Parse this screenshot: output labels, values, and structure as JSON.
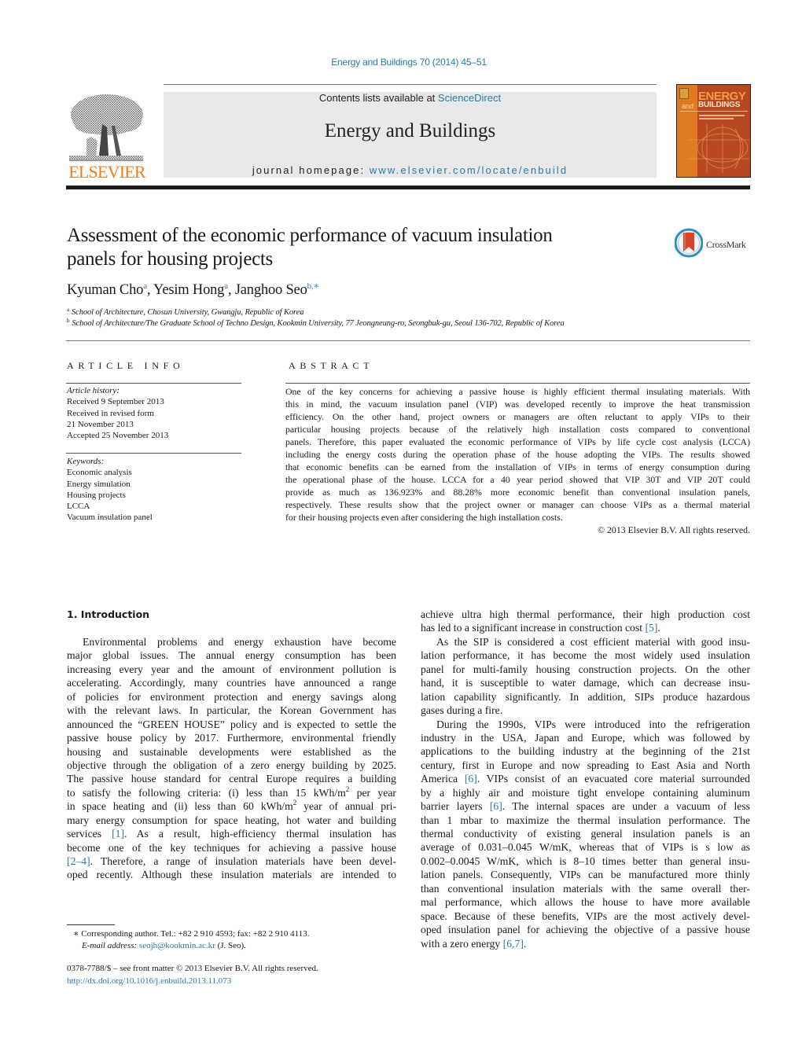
{
  "header": {
    "citation": "Energy and Buildings 70 (2014) 45–51",
    "contents_prefix": "Contents lists available at ",
    "contents_link": "ScienceDirect",
    "journal_title": "Energy and Buildings",
    "homepage_prefix": "journal homepage: ",
    "homepage_link": "www.elsevier.com/locate/enbuild",
    "publisher_logo_text": "ELSEVIER",
    "cover": {
      "line1": "ENERGY",
      "and": "and",
      "line2": "BUILDINGS"
    },
    "colors": {
      "link": "#2a7aa8",
      "elsevier_orange": "#f07d1a",
      "banner_gray": "#e9e9ea",
      "cover_brown": "#b8481f"
    }
  },
  "article": {
    "title_line1": "Assessment of the economic performance of vacuum insulation",
    "title_line2": "panels for housing projects",
    "crossmark_label": "CrossMark",
    "authors": [
      {
        "name": "Kyuman Cho",
        "sup": "a"
      },
      {
        "name": "Yesim Hong",
        "sup": "a"
      },
      {
        "name": "Janghoo Seo",
        "sup": "b,∗"
      }
    ],
    "affiliations": [
      {
        "sup": "a",
        "text": "School of Architecture, Chosun University, Gwangju, Republic of Korea"
      },
      {
        "sup": "b",
        "text": "School of Architecture/The Graduate School of Techno Design, Kookmin University, 77 Jeongneung-ro, Seongbuk-gu, Seoul 136-702, Republic of Korea"
      }
    ]
  },
  "article_info": {
    "heading": "ARTICLE INFO",
    "history_label": "Article history:",
    "history": [
      "Received 9 September 2013",
      "Received in revised form",
      "21 November 2013",
      "Accepted 25 November 2013"
    ],
    "keywords_label": "Keywords:",
    "keywords": [
      "Economic analysis",
      "Energy simulation",
      "Housing projects",
      "LCCA",
      "Vacuum insulation panel"
    ]
  },
  "abstract": {
    "heading": "ABSTRACT",
    "lines": [
      "One of the key concerns for achieving a passive house is highly efficient thermal insulating materials. With",
      "this in mind, the vacuum insulation panel (VIP) was developed recently to improve the heat transmission",
      "efficiency. On the other hand, project owners or managers are often reluctant to apply VIPs to their",
      "particular housing projects because of the relatively high installation costs compared to conventional",
      "panels. Therefore, this paper evaluated the economic performance of VIPs by life cycle cost analysis (LCCA)",
      "including the energy costs during the operation phase of the house adopting the VIPs. The results showed",
      "that economic benefits can be earned from the installation of VIPs in terms of energy consumption during",
      "the operational phase of the house. LCCA for a 40 year period showed that VIP 30T and VIP 20T could",
      "provide as much as 136.923% and 88.28% more economic benefit than conventional insulation panels,",
      "respectively. These results show that the project owner or manager can choose VIPs as a thermal material",
      "for their housing projects even after considering the high installation costs."
    ],
    "copyright": "© 2013 Elsevier B.V. All rights reserved."
  },
  "body": {
    "section_heading": "1.  Introduction",
    "left_lines": [
      "Environmental problems and energy exhaustion have become",
      "major global issues. The annual energy consumption has been",
      "increasing every year and the amount of environment pollution is",
      "accelerating. Accordingly, many countries have announced a range",
      "of policies for environment protection and energy savings along",
      "with the relevant laws. In particular, the Korean Government has",
      "announced the “GREEN HOUSE” policy and is expected to settle the",
      "passive house policy by 2017. Furthermore, environmental friendly",
      "housing and sustainable developments were established as the",
      "objective through the obligation of a zero energy building by 2025.",
      "The passive house standard for central Europe requires a building"
    ],
    "left_line_12": {
      "before": "to satisfy the following criteria: (i) less than 15 kWh/m",
      "sup": "2",
      "after": " per year"
    },
    "left_line_13": {
      "before": "in space heating and (ii) less than 60 kWh/m",
      "sup": "2",
      "after": " year of annual pri-"
    },
    "left_line_14": "mary energy consumption for space heating, hot water and building",
    "left_line_15": {
      "before": "services ",
      "ref": "[1]",
      "after": ". As a result, high-efficiency thermal insulation has"
    },
    "left_line_16": "become one of the key techniques for achieving a passive house",
    "left_line_17": {
      "ref": "[2–4]",
      "after": ". Therefore, a range of insulation materials have been devel-"
    },
    "left_line_18": "oped recently. Although these insulation materials are intended to",
    "right_line_1": "achieve ultra high thermal performance, their high production cost",
    "right_line_2": {
      "before": "has led to a significant increase in construction cost ",
      "ref": "[5]",
      "after": "."
    },
    "right_lines_a": [
      "As the SIP is considered a cost efficient material with good insu-",
      "lation performance, it has become the most widely used insulation",
      "panel for multi-family housing construction projects. On the other",
      "hand, it is susceptible to water damage, which can decrease insu-",
      "lation capability significantly. In addition, SIPs produce hazardous",
      "gases during a fire.",
      "During the 1990s, VIPs were introduced into the refrigeration",
      "industry in the USA, Japan and Europe, which was followed by",
      "applications to the building industry at the beginning of the 21st",
      "century, first in Europe and now spreading to East Asia and North"
    ],
    "right_line_13": {
      "before": "America ",
      "ref": "[6]",
      "after": ". VIPs consist of an evacuated core material surrounded"
    },
    "right_line_14": "by a highly air and moisture tight envelope containing aluminum",
    "right_line_15": {
      "before": "barrier layers ",
      "ref": "[6]",
      "after": ". The internal spaces are under a vacuum of less"
    },
    "right_lines_b": [
      "than 1 mbar to maximize the thermal insulation performance. The",
      "thermal conductivity of existing general insulation panels is an",
      "average of 0.031–0.045 W/mK, whereas that of VIPs is s low as",
      "0.002–0.0045 W/mK, which is 8–10 times better than general insu-",
      "lation panels. Consequently, VIPs can be manufactured more thinly",
      "than conventional insulation materials with the same overall ther-",
      "mal performance, which allows the house to have more available",
      "space. Because of these benefits, VIPs are the most actively devel-",
      "oped insulation panel for achieving the objective of a passive house"
    ],
    "right_last": {
      "before": "with a zero energy ",
      "ref": "[6,7]",
      "after": "."
    }
  },
  "footnotes": {
    "corresponding": "∗  Corresponding author. Tel.: +82 2 910 4593; fax: +82 2 910 4113.",
    "email_label": "E-mail address:",
    "email": "seojh@kookmin.ac.kr",
    "email_suffix": " (J. Seo).",
    "issn_line": "0378-7788/$ – see front matter © 2013 Elsevier B.V. All rights reserved.",
    "doi": "http://dx.doi.org/10.1016/j.enbuild.2013.11.073"
  }
}
